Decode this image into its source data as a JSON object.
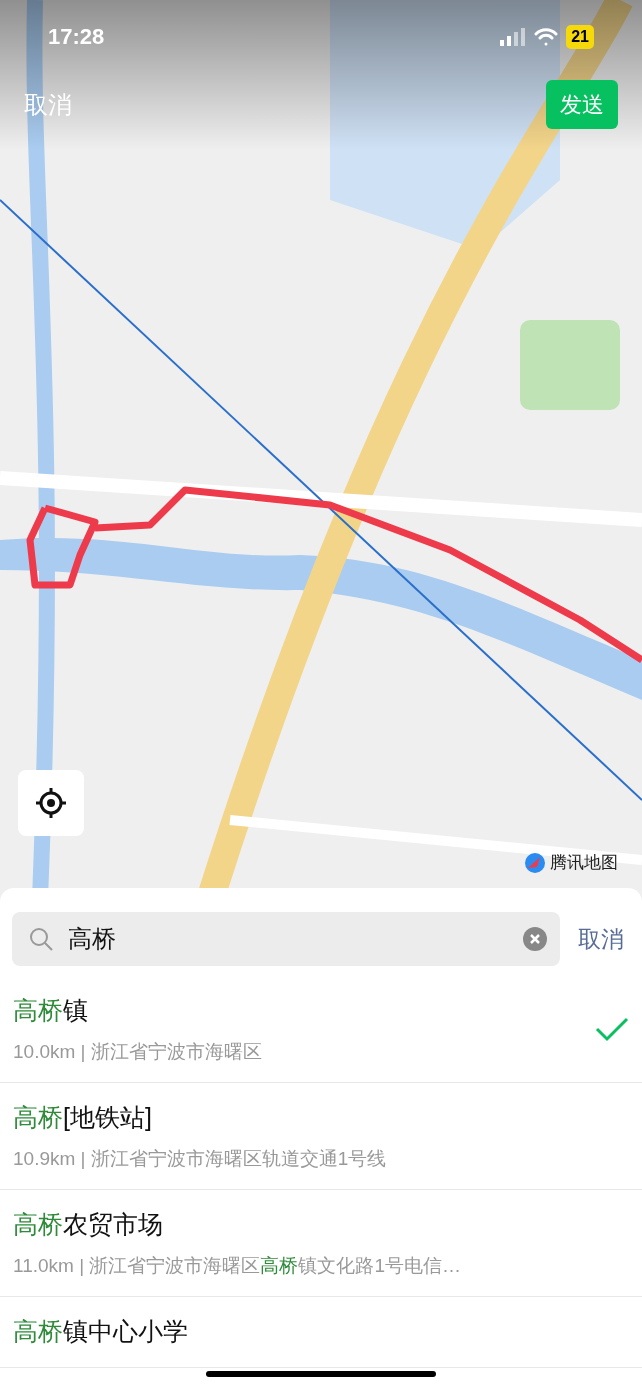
{
  "status_bar": {
    "time": "17:28",
    "battery": "21"
  },
  "top_bar": {
    "cancel": "取消",
    "send": "发送"
  },
  "map": {
    "attribution": "腾讯地图"
  },
  "search": {
    "value": "高桥",
    "cancel": "取消"
  },
  "results": [
    {
      "name": [
        {
          "text": "高桥",
          "match": true
        },
        {
          "text": "镇",
          "match": false
        }
      ],
      "detail": [
        {
          "text": "10.0km | 浙江省宁波市海曙区",
          "match": false
        }
      ],
      "selected": true
    },
    {
      "name": [
        {
          "text": "高桥",
          "match": true
        },
        {
          "text": "[地铁站]",
          "match": false
        }
      ],
      "detail": [
        {
          "text": "10.9km | 浙江省宁波市海曙区轨道交通1号线",
          "match": false
        }
      ],
      "selected": false
    },
    {
      "name": [
        {
          "text": "高桥",
          "match": true
        },
        {
          "text": "农贸市场",
          "match": false
        }
      ],
      "detail": [
        {
          "text": "11.0km | 浙江省宁波市海曙区",
          "match": false
        },
        {
          "text": "高桥",
          "match": true
        },
        {
          "text": "镇文化路1号电信…",
          "match": false
        }
      ],
      "selected": false
    },
    {
      "name": [
        {
          "text": "高桥",
          "match": true
        },
        {
          "text": "镇中心小学",
          "match": false
        }
      ],
      "selected": false
    }
  ]
}
